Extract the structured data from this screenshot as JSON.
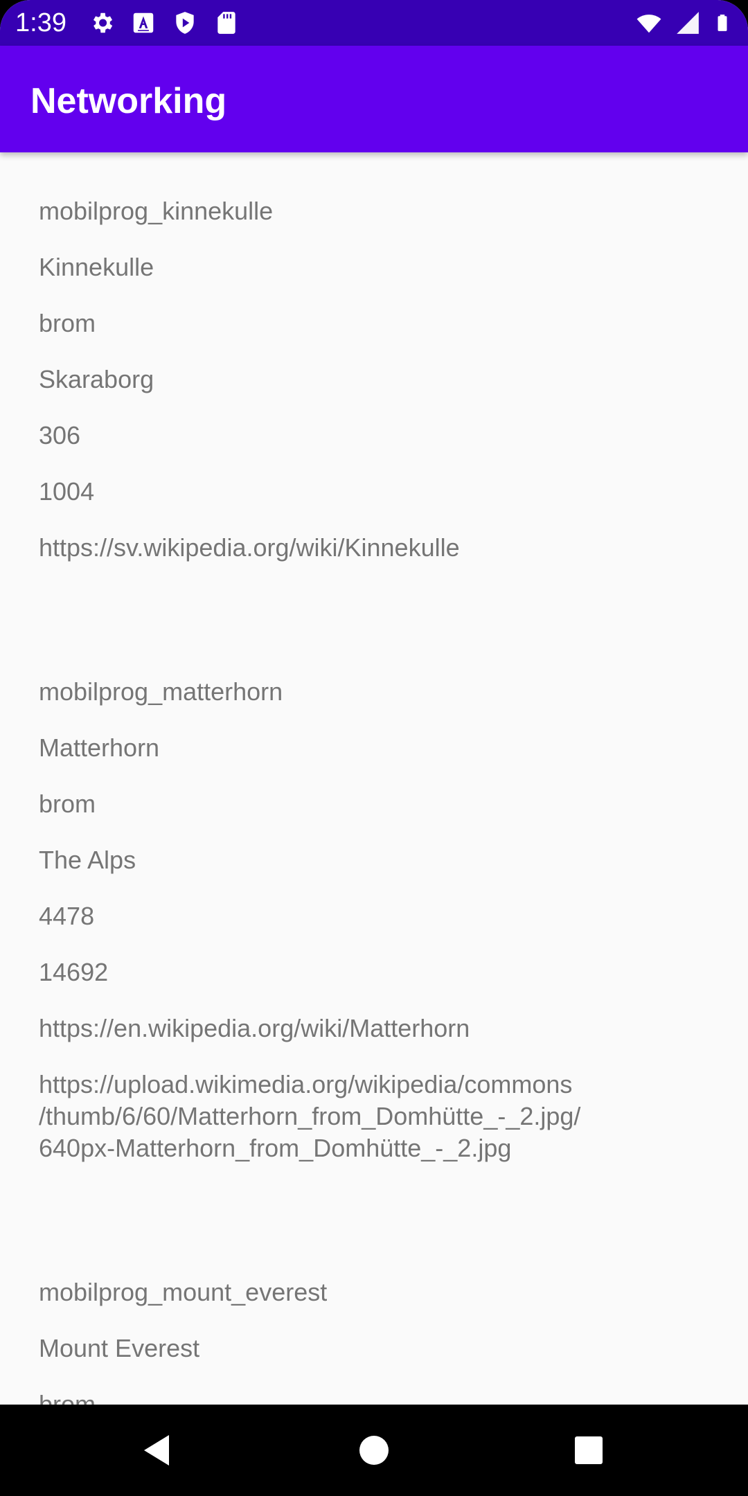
{
  "status_bar": {
    "time": "1:39",
    "left_icons": [
      "gear-icon",
      "font-a-icon",
      "play-shield-icon",
      "sd-card-icon"
    ],
    "right_icons": [
      "wifi-icon",
      "signal-icon",
      "battery-icon"
    ]
  },
  "app_bar": {
    "title": "Networking"
  },
  "items": [
    {
      "id": "mobilprog_kinnekulle",
      "name": "Kinnekulle",
      "type": "brom",
      "location": "Skaraborg",
      "height": "306",
      "size": "1004",
      "wiki": "https://sv.wikipedia.org/wiki/Kinnekulle"
    },
    {
      "id": "mobilprog_matterhorn",
      "name": "Matterhorn",
      "type": "brom",
      "location": "The Alps",
      "height": "4478",
      "size": "14692",
      "wiki": "https://en.wikipedia.org/wiki/Matterhorn",
      "image_line1": "https://upload.wikimedia.org/wikipedia/commons",
      "image_line2": "/thumb/6/60/Matterhorn_from_Domhütte_-_2.jpg/",
      "image_line3": "640px-Matterhorn_from_Domhütte_-_2.jpg"
    },
    {
      "id": "mobilprog_mount_everest",
      "name": "Mount Everest",
      "type": "brom"
    }
  ],
  "colors": {
    "status_bar": "#3700b3",
    "app_bar": "#6200ee",
    "background": "#fafafa",
    "text": "#757575"
  },
  "nav_bar": {
    "icons": [
      "back-icon",
      "home-icon",
      "recents-icon"
    ]
  }
}
